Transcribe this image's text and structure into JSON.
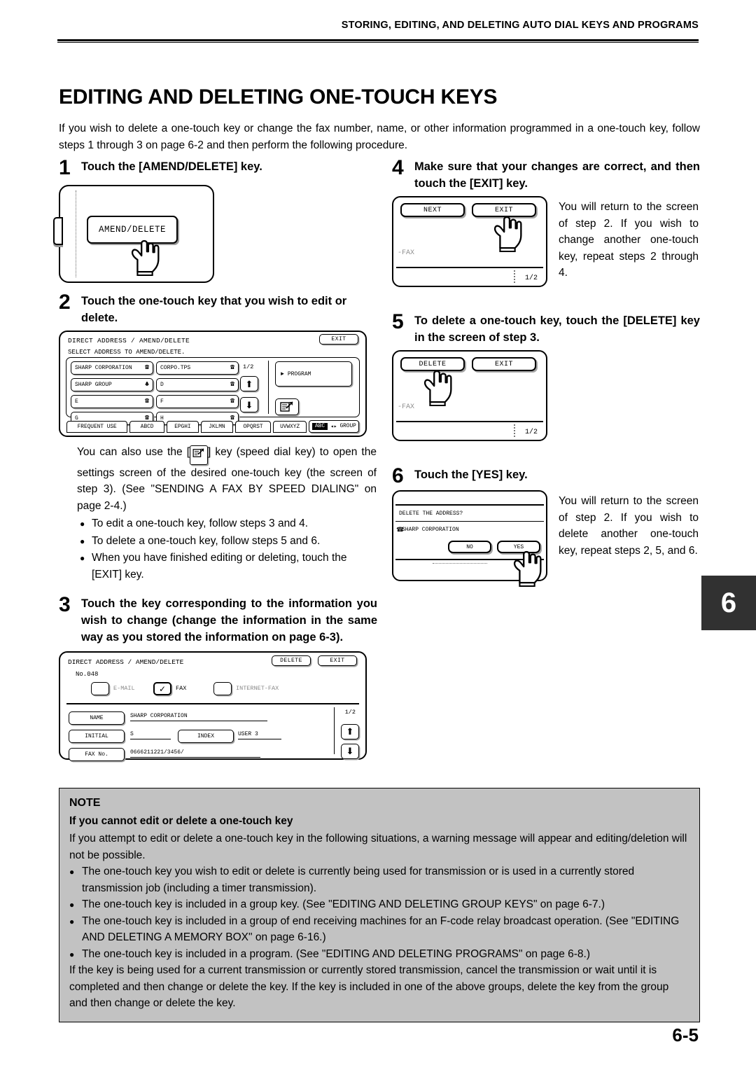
{
  "header": {
    "running_head": "STORING, EDITING, AND DELETING AUTO DIAL KEYS AND PROGRAMS"
  },
  "title": "EDITING AND DELETING ONE-TOUCH KEYS",
  "intro": "If you wish to delete a one-touch key or change the fax number, name, or other information programmed in a one-touch key, follow steps 1 through 3 on page 6-2 and then perform the following procedure.",
  "steps": {
    "s1": {
      "num": "1",
      "title": "Touch the [AMEND/DELETE] key.",
      "key_label": "AMEND/DELETE"
    },
    "s2": {
      "num": "2",
      "title": "Touch the one-touch key that you wish to edit or delete.",
      "screen": {
        "title": "DIRECT ADDRESS / AMEND/DELETE",
        "exit": "EXIT",
        "subtitle": "SELECT ADDRESS TO AMEND/DELETE.",
        "page_indicator": "1/2",
        "program_label": "PROGRAM",
        "keys_left": [
          {
            "label": "SHARP CORPORATION",
            "icon": "phone-icon"
          },
          {
            "label": "SHARP GROUP",
            "icon": "group-icon"
          },
          {
            "label": "E",
            "icon": "phone-icon"
          },
          {
            "label": "G",
            "icon": "phone-icon"
          }
        ],
        "keys_right": [
          {
            "label": "CORPO.TPS",
            "icon": "phone-icon"
          },
          {
            "label": "D",
            "icon": "phone-icon"
          },
          {
            "label": "F",
            "icon": "phone-icon"
          },
          {
            "label": "H",
            "icon": "phone-icon"
          }
        ],
        "tabs": [
          "FREQUENT USE",
          "ABCD",
          "EPGHI",
          "JKLMN",
          "OPQRST",
          "UVWXYZ"
        ],
        "group_toggle": {
          "selected": "ABC",
          "other": "GROUP"
        }
      },
      "note_text": "You can also use the [",
      "note_text2": "] key (speed dial key) to open the settings screen of the desired one-touch key (the screen of step 3). (See \"SENDING A FAX BY SPEED DIALING\" on page 2-4.)",
      "bullets": [
        "To edit a one-touch key, follow steps 3 and 4.",
        "To delete a one-touch key, follow steps 5 and 6.",
        "When you have finished editing or deleting, touch the [EXIT] key."
      ]
    },
    "s3": {
      "num": "3",
      "title": "Touch the key corresponding to the information you wish to change (change the information in the same way as you stored the information on page 6-3).",
      "screen": {
        "title": "DIRECT ADDRESS / AMEND/DELETE",
        "delete": "DELETE",
        "exit": "EXIT",
        "number": "No.048",
        "checkboxes": [
          {
            "label": "E-MAIL",
            "checked": false
          },
          {
            "label": "FAX",
            "checked": true
          },
          {
            "label": "INTERNET-FAX",
            "checked": false
          }
        ],
        "fields": [
          {
            "key": "NAME",
            "value": "SHARP CORPORATION"
          },
          {
            "key": "INITIAL",
            "value": "S"
          },
          {
            "key": "INDEX",
            "value": "USER 3"
          },
          {
            "key": "FAX No.",
            "value": "0666211221/3456/"
          }
        ],
        "page_indicator": "1/2"
      }
    },
    "s4": {
      "num": "4",
      "title": "Make sure that your changes are correct, and then touch the [EXIT] key.",
      "screen": {
        "next": "NEXT",
        "exit": "EXIT",
        "fax_label": "FAX",
        "page_indicator": "1/2"
      },
      "note": "You will return to the screen of step 2. If you wish to change another one-touch key, repeat steps 2 through 4."
    },
    "s5": {
      "num": "5",
      "title": "To delete a one-touch key, touch the [DELETE] key in the screen of step 3.",
      "screen": {
        "delete": "DELETE",
        "exit": "EXIT",
        "fax_label": "FAX",
        "page_indicator": "1/2"
      }
    },
    "s6": {
      "num": "6",
      "title": "Touch the [YES] key.",
      "screen": {
        "question": "DELETE THE ADDRESS?",
        "address": "SHARP CORPORATION",
        "no": "NO",
        "yes": "YES"
      },
      "note": "You will return to the screen of step 2. If you wish to delete another one-touch key, repeat steps 2, 5, and 6."
    }
  },
  "note_box": {
    "heading": "NOTE",
    "subheading": "If you cannot edit or delete a one-touch key",
    "paragraph": "If you attempt to edit or delete a one-touch key in the following situations, a warning message will appear and editing/deletion will not be possible.",
    "bullets": [
      "The one-touch key you wish to edit or delete is currently being used for transmission or is used in a currently stored transmission job (including a timer transmission).",
      "The one-touch key is included in a group key. (See \"EDITING AND DELETING GROUP KEYS\" on page 6-7.)",
      "The one-touch key is included in a group of end receiving machines for an F-code relay broadcast operation. (See \"EDITING AND DELETING A MEMORY BOX\" on page 6-16.)",
      "The one-touch key is included in a program. (See \"EDITING AND DELETING PROGRAMS\" on page 6-8.)"
    ],
    "closing": "If the key is being used for a current transmission or currently stored transmission, cancel the transmission or wait until it is completed and then change or delete the key. If the key is included in one of the above groups, delete the key from the group and then change or delete the key."
  },
  "chapter_tab": "6",
  "folio": "6-5",
  "colors": {
    "note_background": "#c2c2c2",
    "chapter_tab_background": "#313131",
    "key_shadow": "#9a9a9a",
    "dim_text": "#8f8f8f"
  }
}
